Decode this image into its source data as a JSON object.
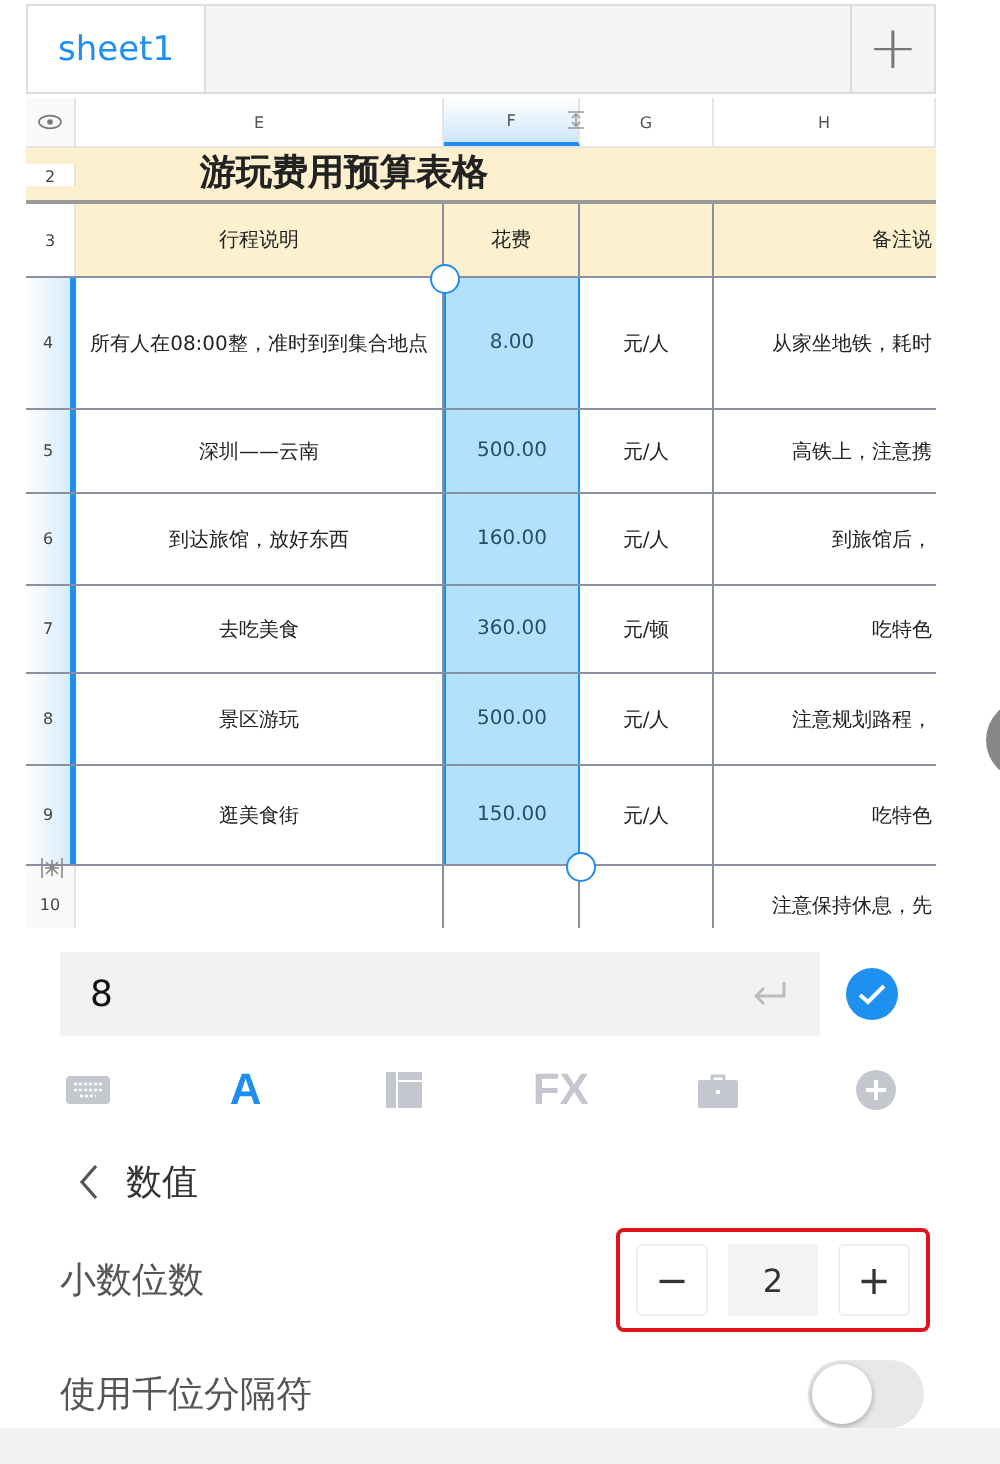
{
  "sheet_tabs": [
    {
      "label": "sheet1",
      "selected": true
    }
  ],
  "add_sheet": "+",
  "columns": [
    {
      "label": "E",
      "selected": false
    },
    {
      "label": "F",
      "selected": true
    },
    {
      "label": "G",
      "selected": false
    },
    {
      "label": "H",
      "selected": false
    }
  ],
  "title_row": {
    "number": "2",
    "text": "游玩费用预算表格"
  },
  "header_row": {
    "number": "3",
    "cells": [
      "行程说明",
      "花费",
      "",
      "备注说"
    ]
  },
  "rows": [
    {
      "number": "4",
      "selected": true,
      "cells": [
        "所有人在08:00整，准时到到集合地点",
        "8.00",
        "元/人",
        "从家坐地铁，耗时"
      ]
    },
    {
      "number": "5",
      "selected": true,
      "cells": [
        "深圳——云南",
        "500.00",
        "元/人",
        "高铁上，注意携"
      ]
    },
    {
      "number": "6",
      "selected": true,
      "cells": [
        "到达旅馆，放好东西",
        "160.00",
        "元/人",
        "到旅馆后，"
      ]
    },
    {
      "number": "7",
      "selected": true,
      "cells": [
        "去吃美食",
        "360.00",
        "元/顿",
        "吃特色"
      ]
    },
    {
      "number": "8",
      "selected": true,
      "cells": [
        "景区游玩",
        "500.00",
        "元/人",
        "注意规划路程，"
      ]
    },
    {
      "number": "9",
      "selected": true,
      "cells": [
        "逛美食街",
        "150.00",
        "元/人",
        "吃特色"
      ]
    },
    {
      "number": "10",
      "selected": false,
      "cells": [
        "",
        "",
        "",
        "注意保持休息，先"
      ]
    }
  ],
  "input": {
    "value": "8"
  },
  "toolbar": [
    {
      "kind": "keyboard",
      "selected": false
    },
    {
      "kind": "text",
      "label": "A",
      "selected": true
    },
    {
      "kind": "layout",
      "selected": false
    },
    {
      "kind": "text",
      "label": "FX",
      "selected": false
    },
    {
      "kind": "briefcase",
      "selected": false
    },
    {
      "kind": "plus",
      "selected": false
    }
  ],
  "panel": {
    "title": "数值",
    "decimal": {
      "label": "小数位数",
      "minus": "−",
      "value": "2",
      "plus": "+",
      "highlighted": true
    },
    "thousands": {
      "label": "使用千位分隔符",
      "on": false
    }
  }
}
